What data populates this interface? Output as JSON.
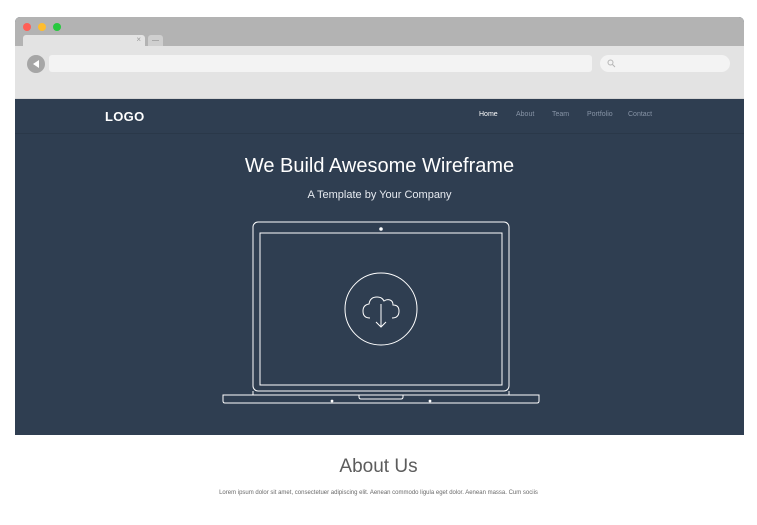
{
  "browser": {
    "traffic_colors": [
      "#ff5f56",
      "#ffbd2e",
      "#27c93f"
    ],
    "tab_close_glyph": "×",
    "back_icon": "back-arrow-icon",
    "search_icon": "magnifier-icon"
  },
  "site": {
    "logo": "LOGO",
    "nav": [
      "Home",
      "About",
      "Team",
      "Portfolio",
      "Contact"
    ],
    "active_nav": "Home",
    "hero": {
      "title": "We Build Awesome Wireframe",
      "subtitle": "A Template by Your Company",
      "illustration_icon": "cloud-download-icon"
    },
    "colors": {
      "hero_bg": "#2f3e51",
      "nav_inactive": "#8794a6",
      "nav_active": "#ffffff"
    }
  },
  "about": {
    "title": "About Us",
    "text": "Lorem ipsum dolor sit amet, consectetuer adipiscing elit. Aenean commodo ligula eget dolor. Aenean massa. Cum sociis"
  }
}
